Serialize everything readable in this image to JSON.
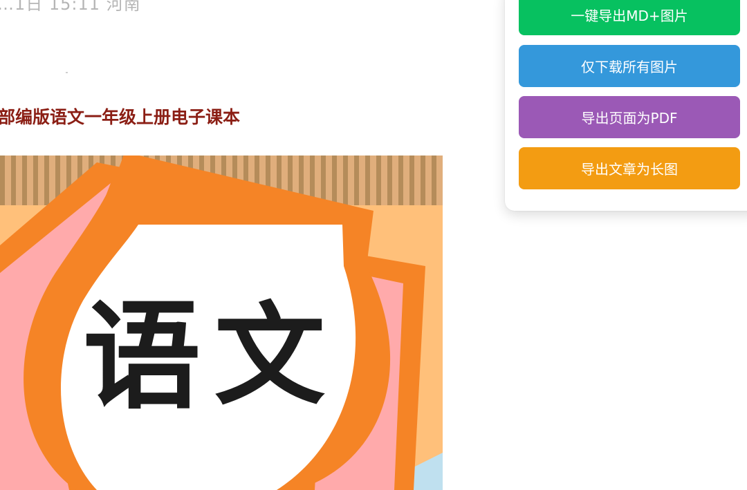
{
  "header": {
    "meta_text": "…1日 15:11  河南"
  },
  "article": {
    "title": "部编版语文一年级上册电子课本",
    "cover": {
      "characters": [
        "语",
        "文"
      ],
      "colors": {
        "background": "#ffc07a",
        "stripe_light": "#e0ae7c",
        "stripe_dark": "#b58c5a",
        "frame": "#f58426",
        "petal": "#ffaaab",
        "ink": "#1c1c1c",
        "sky": "#bfe0ef"
      }
    }
  },
  "toolbar": {
    "buttons": [
      {
        "label": "一键导出MD+图片",
        "color": "#07c160"
      },
      {
        "label": "仅下载所有图片",
        "color": "#3498db"
      },
      {
        "label": "导出页面为PDF",
        "color": "#9b59b6"
      },
      {
        "label": "导出文章为长图",
        "color": "#f39c12"
      }
    ]
  }
}
